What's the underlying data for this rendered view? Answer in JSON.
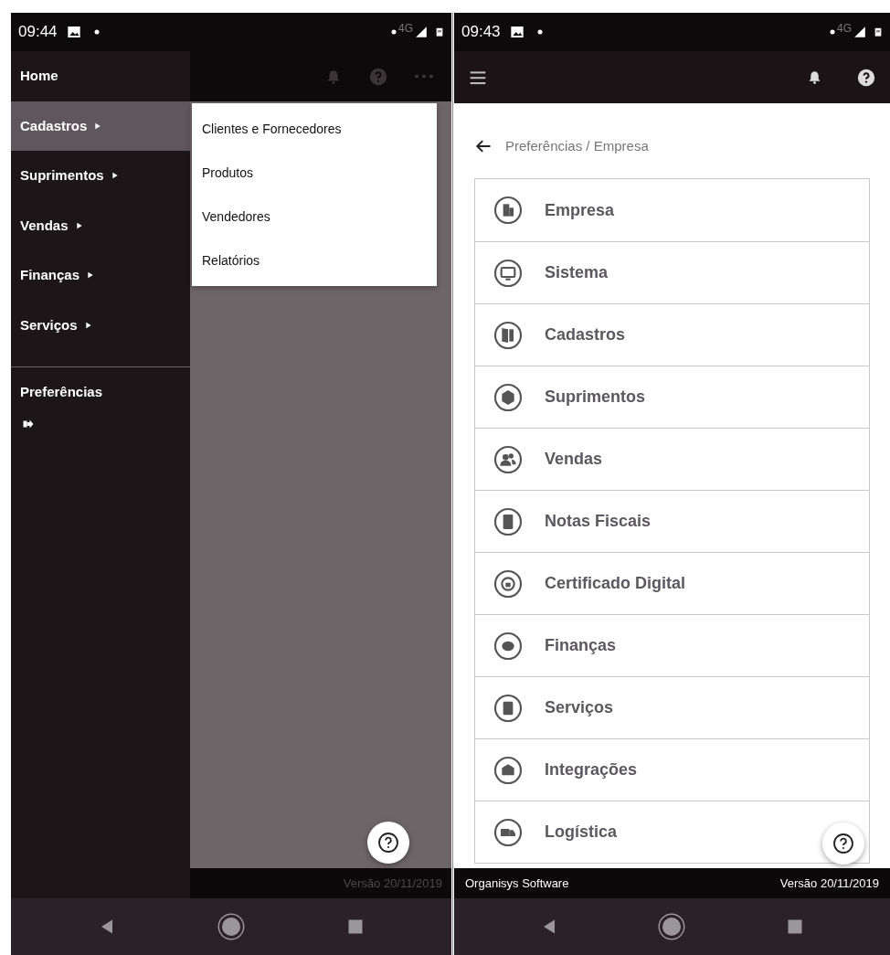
{
  "left_screen": {
    "status_bar": {
      "time": "09:44",
      "network": "4G"
    },
    "drawer": {
      "items": [
        {
          "label": "Home",
          "has_submenu": false,
          "selected": false
        },
        {
          "label": "Cadastros",
          "has_submenu": true,
          "selected": true
        },
        {
          "label": "Suprimentos",
          "has_submenu": true,
          "selected": false
        },
        {
          "label": "Vendas",
          "has_submenu": true,
          "selected": false
        },
        {
          "label": "Finanças",
          "has_submenu": true,
          "selected": false
        },
        {
          "label": "Serviços",
          "has_submenu": true,
          "selected": false
        }
      ],
      "secondary_items": [
        {
          "label": "Preferências"
        }
      ]
    },
    "submenu": {
      "items": [
        "Clientes e Fornecedores",
        "Produtos",
        "Vendedores",
        "Relatórios"
      ]
    },
    "footer": {
      "version": "Versão 20/11/2019"
    }
  },
  "right_screen": {
    "status_bar": {
      "time": "09:43",
      "network": "4G"
    },
    "breadcrumb": "Preferências / Empresa",
    "settings_list": [
      {
        "label": "Empresa"
      },
      {
        "label": "Sistema"
      },
      {
        "label": "Cadastros"
      },
      {
        "label": "Suprimentos"
      },
      {
        "label": "Vendas"
      },
      {
        "label": "Notas Fiscais"
      },
      {
        "label": "Certificado Digital"
      },
      {
        "label": "Finanças"
      },
      {
        "label": "Serviços"
      },
      {
        "label": "Integrações"
      },
      {
        "label": "Logística"
      }
    ],
    "footer": {
      "company": "Organisys Software",
      "version": "Versão 20/11/2019"
    }
  }
}
